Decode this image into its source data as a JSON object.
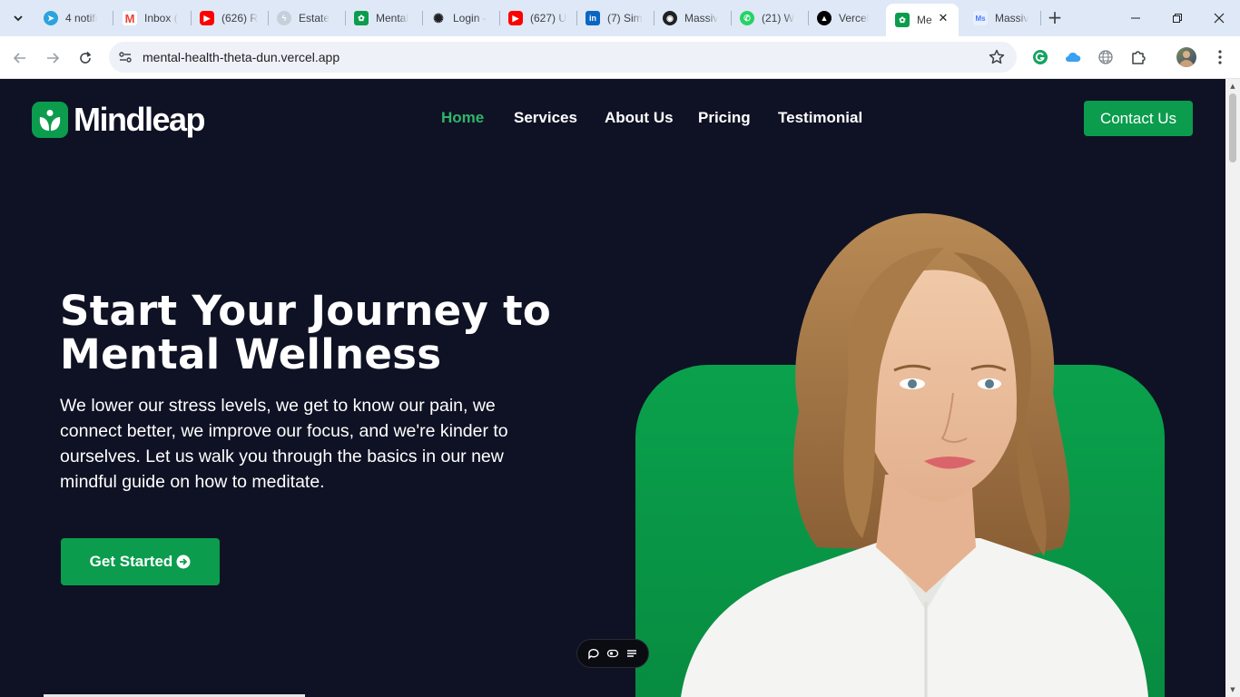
{
  "browser": {
    "tabs": [
      {
        "title": "4 notifi",
        "icon": "telegram-icon",
        "color": "#2aa3df"
      },
      {
        "title": "Inbox (",
        "icon": "gmail-icon",
        "color": "#ea4335"
      },
      {
        "title": "(626) R",
        "icon": "youtube-icon",
        "color": "#ff0000"
      },
      {
        "title": "Estate",
        "icon": "bolt-icon",
        "color": "#9aa6b8"
      },
      {
        "title": "Mental",
        "icon": "mindleap-icon",
        "color": "#0b9c4d"
      },
      {
        "title": "Login -",
        "icon": "openai-icon",
        "color": "#202124"
      },
      {
        "title": "(627) U",
        "icon": "youtube-icon",
        "color": "#ff0000"
      },
      {
        "title": "(7) Sim",
        "icon": "linkedin-icon",
        "color": "#0a66c2"
      },
      {
        "title": "Massiv",
        "icon": "github-icon",
        "color": "#202124"
      },
      {
        "title": "(21) W",
        "icon": "whatsapp-icon",
        "color": "#25d366"
      },
      {
        "title": "Vercel",
        "icon": "vercel-icon",
        "color": "#000000"
      },
      {
        "title": "Me",
        "icon": "mindleap-icon",
        "color": "#0b9c4d",
        "active": true
      },
      {
        "title": "Massiv",
        "icon": "massive-icon",
        "color": "#4a7bf7"
      }
    ],
    "url": "mental-health-theta-dun.vercel.app"
  },
  "site": {
    "brand": "Mindleap",
    "nav": [
      {
        "label": "Home",
        "active": true
      },
      {
        "label": "Services"
      },
      {
        "label": "About Us"
      },
      {
        "label": "Pricing"
      },
      {
        "label": "Testimonial"
      }
    ],
    "contact_label": "Contact Us",
    "hero": {
      "title_line1": "Start Your Journey to",
      "title_line2": "Mental Wellness",
      "text": "We lower our stress levels, we get to know our pain, we connect better, we improve our focus, and we're kinder to ourselves. Let us walk you through the basics in our new mindful guide on how to meditate.",
      "cta_label": "Get Started"
    }
  },
  "colors": {
    "brand_green": "#0b9c4d",
    "nav_active": "#2fb56a",
    "page_bg": "#0f1224"
  }
}
